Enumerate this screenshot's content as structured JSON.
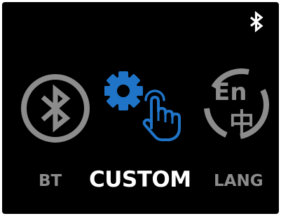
{
  "colors": {
    "background": "#000000",
    "active": "#ffffff",
    "inactive": "#8c8c8c",
    "accent": "#1f74c8"
  },
  "status_bar": {
    "icon": "bluetooth-icon"
  },
  "menu": {
    "selected_index": 1,
    "items": [
      {
        "label": "BT",
        "icon": "bluetooth-circle-icon"
      },
      {
        "label": "CUSTOM",
        "icon": "gear-hand-icon"
      },
      {
        "label": "LANG",
        "icon": "language-icon",
        "icon_text_top": "En",
        "icon_text_bottom": "中"
      }
    ]
  }
}
